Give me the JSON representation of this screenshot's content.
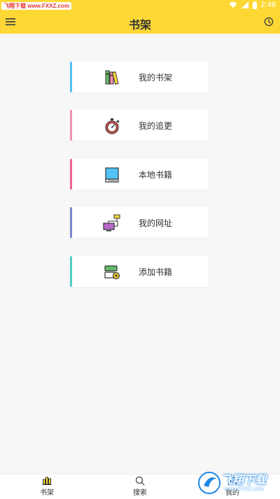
{
  "status_bar": {
    "watermark": "飞翔下载 www.FXXZ.com",
    "time": "2:46",
    "icons": [
      "wifi-icon",
      "signal-icon",
      "battery-icon"
    ]
  },
  "app_bar": {
    "title": "书架",
    "left_icon": "menu-icon",
    "right_icon": "history-clock-icon",
    "color": "#fdd835"
  },
  "cards": [
    {
      "label": "我的书架",
      "icon": "books-icon",
      "accent": "#4fc3f7"
    },
    {
      "label": "我的追更",
      "icon": "stopwatch-icon",
      "accent": "#f48fb1"
    },
    {
      "label": "本地书籍",
      "icon": "local-book-icon",
      "accent": "#f06292"
    },
    {
      "label": "我的网址",
      "icon": "network-icon",
      "accent": "#7986cb"
    },
    {
      "label": "添加书籍",
      "icon": "add-book-icon",
      "accent": "#4dd0c4"
    }
  ],
  "bottom_nav": [
    {
      "label": "书架",
      "icon": "bookshelf-chart-icon",
      "active": true
    },
    {
      "label": "搜索",
      "icon": "search-icon",
      "active": false
    },
    {
      "label": "我的",
      "icon": "profile-icon",
      "active": false
    }
  ],
  "corner_watermark": {
    "text": "飞翔下载",
    "url": "www.FXXZ.com"
  }
}
